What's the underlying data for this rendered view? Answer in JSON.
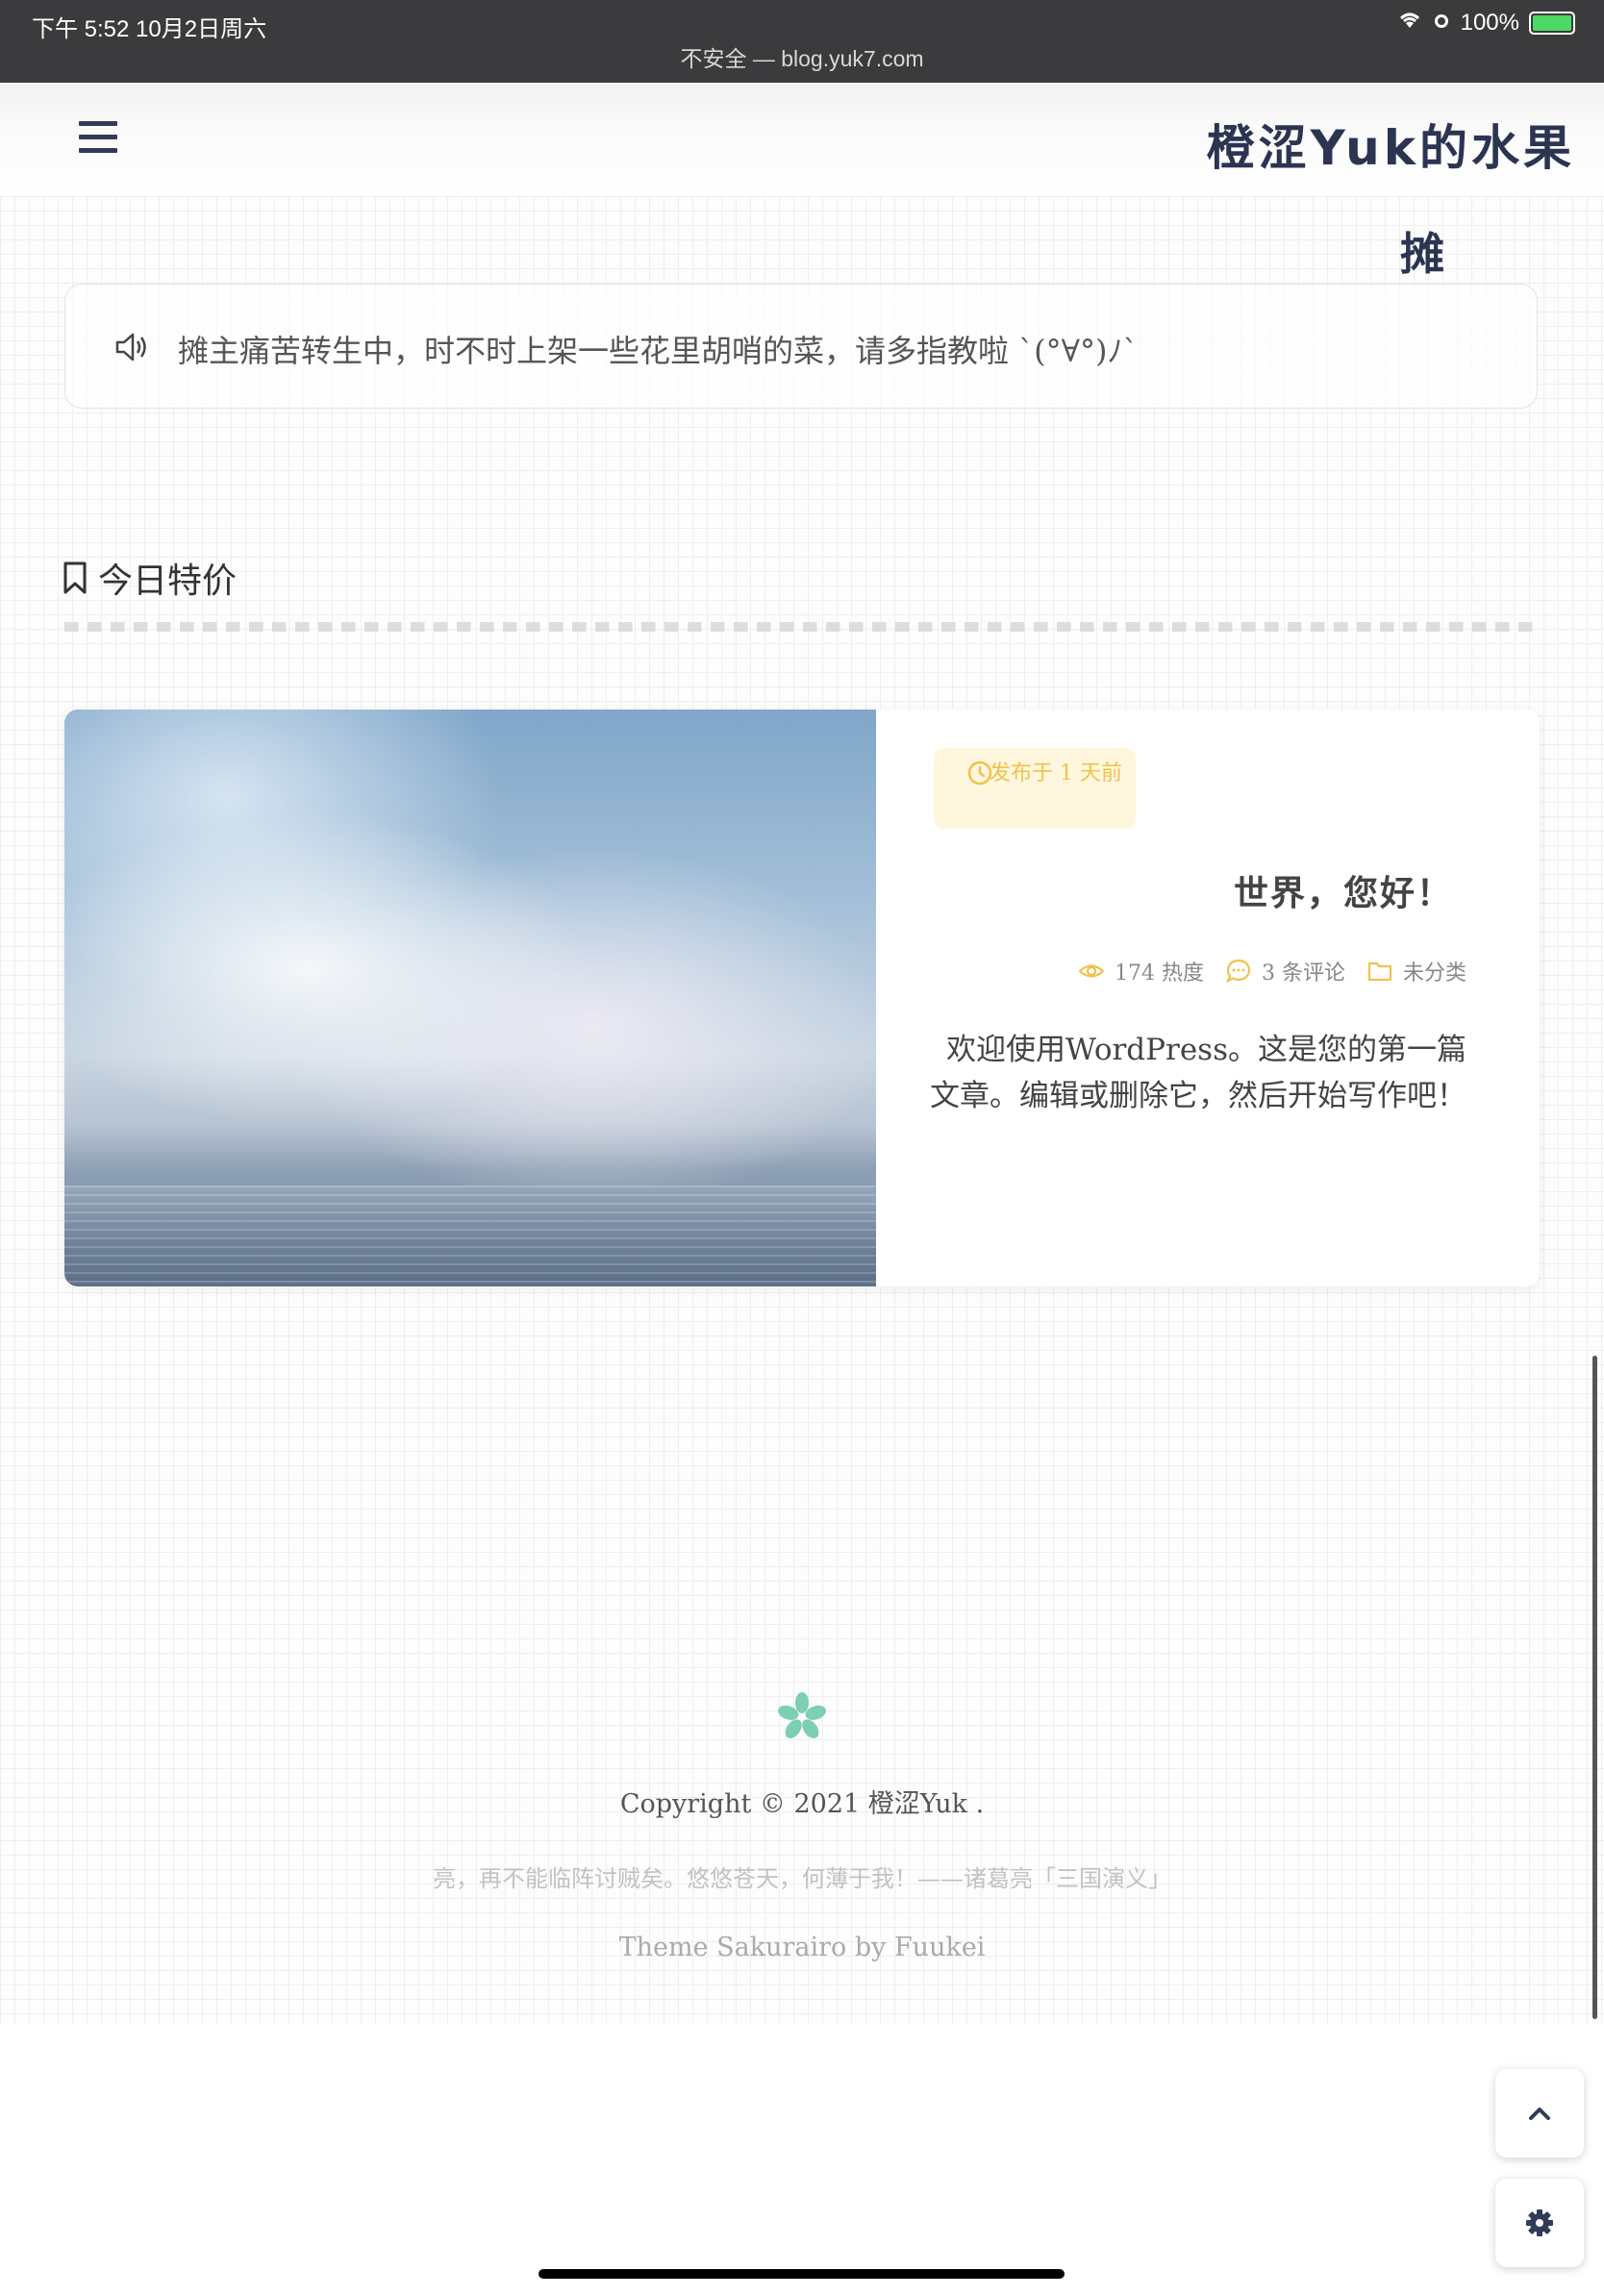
{
  "status_bar": {
    "time": "下午 5:52   10月2日周六",
    "battery": "100%",
    "url": "不安全 — blog.yuk7.com"
  },
  "header": {
    "site_title": "橙涩Yuk的水果",
    "site_title_line2": "摊"
  },
  "notice": {
    "text": "摊主痛苦转生中，时不时上架一些花里胡哨的菜，请多指教啦 `(°∀°)ﾉ`"
  },
  "section": {
    "title": "今日特价"
  },
  "post": {
    "date": "发布于 1 天前",
    "title": "世界，您好！",
    "views": "174 热度",
    "comments": "3 条评论",
    "category": "未分类",
    "excerpt": "欢迎使用WordPress。这是您的第一篇文章。编辑或删除它，然后开始写作吧！"
  },
  "footer": {
    "copyright": "Copyright © 2021 橙涩Yuk .",
    "quote": "亮，再不能临阵讨贼矣。悠悠苍天，何薄于我！——诸葛亮「三国演义」",
    "theme": "Theme Sakurairo by Fuukei"
  },
  "colors": {
    "accent": "#f1c24a",
    "title_blue": "#2b3552",
    "flower": "#7ccfb0"
  }
}
